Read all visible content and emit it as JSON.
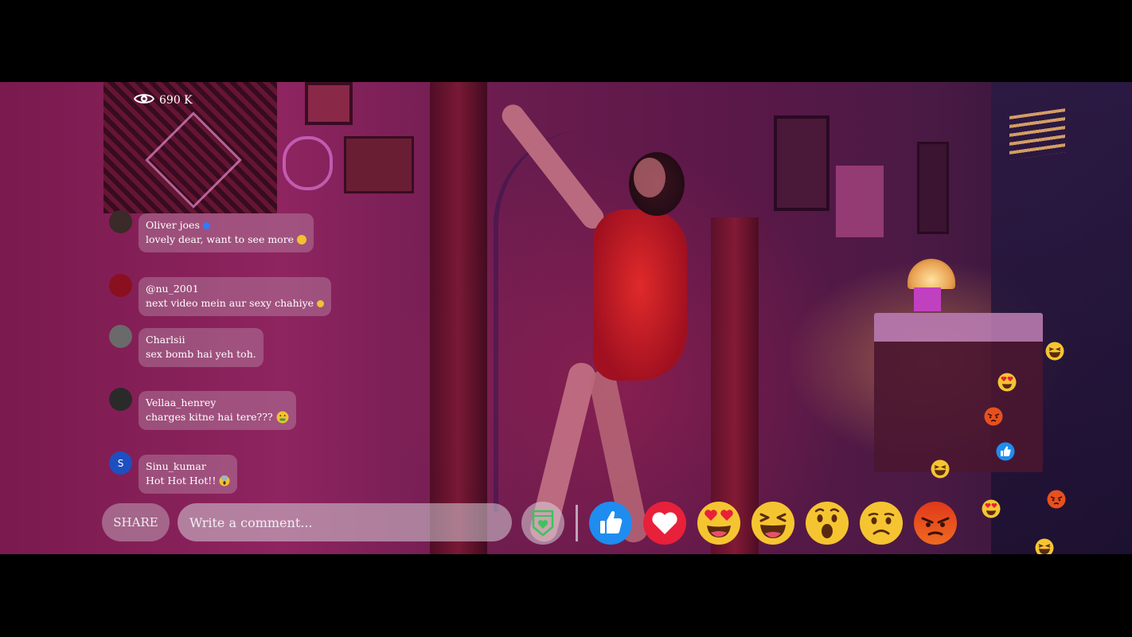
{
  "viewers": {
    "icon": "eye-icon",
    "count": "690 K"
  },
  "comments": [
    {
      "name": "Oliver joes",
      "verified": true,
      "message": "lovely dear, want to see more",
      "emoji": "slight-smile",
      "avatar_color": "#3a2a28"
    },
    {
      "name": "@nu_2001",
      "verified": false,
      "message": "next video mein aur sexy chahiye",
      "emoji": "smile",
      "avatar_color": "#8a1020"
    },
    {
      "name": "Charlsii",
      "verified": false,
      "message": "sex bomb hai yeh toh.",
      "emoji": "",
      "avatar_color": "#6a6a6a"
    },
    {
      "name": "Vellaa_henrey",
      "verified": false,
      "message": "charges kitne hai tere???",
      "emoji": "money-mouth",
      "avatar_color": "#2a2a2a"
    },
    {
      "name": "Sinu_kumar",
      "verified": false,
      "message": "Hot Hot Hot!!",
      "emoji": "scream",
      "avatar_color": "#1e4fc0",
      "avatar_letter": "S"
    }
  ],
  "bottom_bar": {
    "share_label": "SHARE",
    "comment_placeholder": "Write a comment...",
    "shield_icon": "shield-heart-icon"
  },
  "reactions": [
    "like",
    "love",
    "heart-eyes",
    "laugh",
    "wow",
    "sad",
    "angry"
  ],
  "floating_reactions": [
    "laugh",
    "heart-eyes",
    "angry",
    "like",
    "laugh",
    "heart-eyes",
    "angry",
    "laugh"
  ],
  "colors": {
    "like_blue": "#1f8cf0",
    "love_red": "#e8203a",
    "emoji_yellow": "#f5c531",
    "angry_orange": "#e8501e",
    "shield_green": "#3cc45a"
  }
}
